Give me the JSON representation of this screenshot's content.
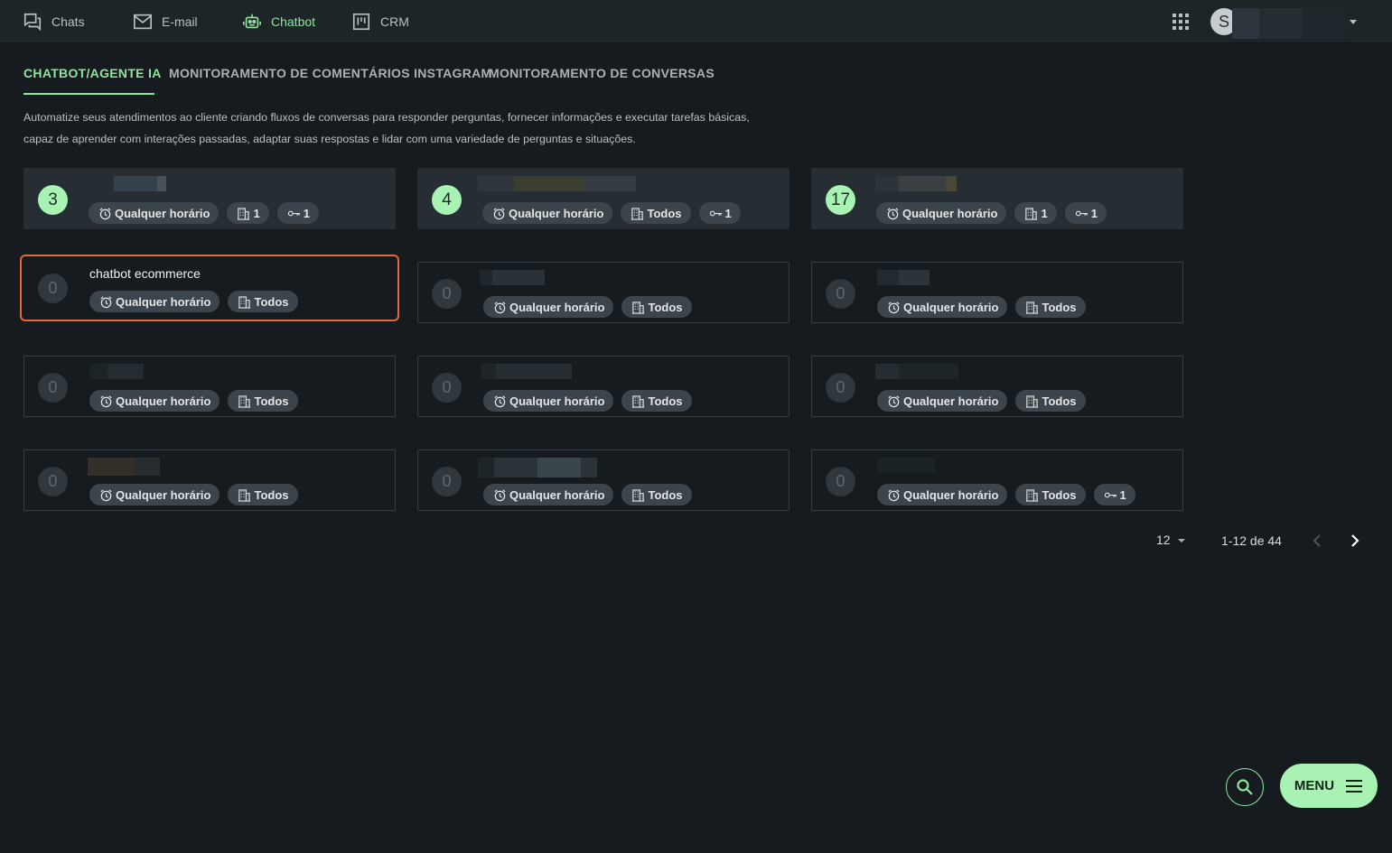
{
  "nav": {
    "chats": "Chats",
    "email": "E-mail",
    "chatbot": "Chatbot",
    "crm": "CRM"
  },
  "user": {
    "initial": "S"
  },
  "tabs": {
    "chatbot_agent": "CHATBOT/AGENTE IA",
    "instagram": "MONITORAMENTO DE COMENTÁRIOS INSTAGRAM",
    "conversations": "MONITORAMENTO DE CONVERSAS"
  },
  "description": {
    "line1": "Automatize seus atendimentos ao cliente criando fluxos de conversas para responder perguntas, fornecer informações e executar tarefas básicas,",
    "line2": "capaz de aprender com interações passadas, adaptar suas respostas e lidar com uma variedade de perguntas e situações."
  },
  "cards": [
    {
      "count": "3",
      "title": "",
      "schedule": "Qualquer horário",
      "departments": "1",
      "keys": "1"
    },
    {
      "count": "4",
      "title": "",
      "schedule": "Qualquer horário",
      "departments": "Todos",
      "keys": "1"
    },
    {
      "count": "17",
      "title": "",
      "schedule": "Qualquer horário",
      "departments": "1",
      "keys": "1"
    },
    {
      "count": "0",
      "title": "chatbot ecommerce",
      "schedule": "Qualquer horário",
      "departments": "Todos"
    },
    {
      "count": "0",
      "title": "",
      "schedule": "Qualquer horário",
      "departments": "Todos"
    },
    {
      "count": "0",
      "title": "",
      "schedule": "Qualquer horário",
      "departments": "Todos"
    },
    {
      "count": "0",
      "title": "",
      "schedule": "Qualquer horário",
      "departments": "Todos"
    },
    {
      "count": "0",
      "title": "",
      "schedule": "Qualquer horário",
      "departments": "Todos"
    },
    {
      "count": "0",
      "title": "",
      "schedule": "Qualquer horário",
      "departments": "Todos"
    },
    {
      "count": "0",
      "title": "",
      "schedule": "Qualquer horário",
      "departments": "Todos"
    },
    {
      "count": "0",
      "title": "",
      "schedule": "Qualquer horário",
      "departments": "Todos"
    },
    {
      "count": "0",
      "title": "",
      "schedule": "Qualquer horário",
      "departments": "Todos",
      "keys": "1"
    }
  ],
  "pagination": {
    "per_page": "12",
    "range": "1-12 de 44"
  },
  "menu_button": {
    "label": "MENU"
  },
  "icons": {
    "chats": "chat-bubbles-icon",
    "email": "envelope-icon",
    "chatbot": "robot-icon",
    "crm": "kanban-board-icon",
    "apps": "apps-grid-icon",
    "schedule": "alarm-clock-icon",
    "departments": "building-icon",
    "keys": "key-icon",
    "search": "search-icon",
    "menu": "hamburger-icon"
  },
  "colors": {
    "accent": "#8ee59c",
    "highlight": "#e8673a",
    "background": "#151b1f"
  }
}
